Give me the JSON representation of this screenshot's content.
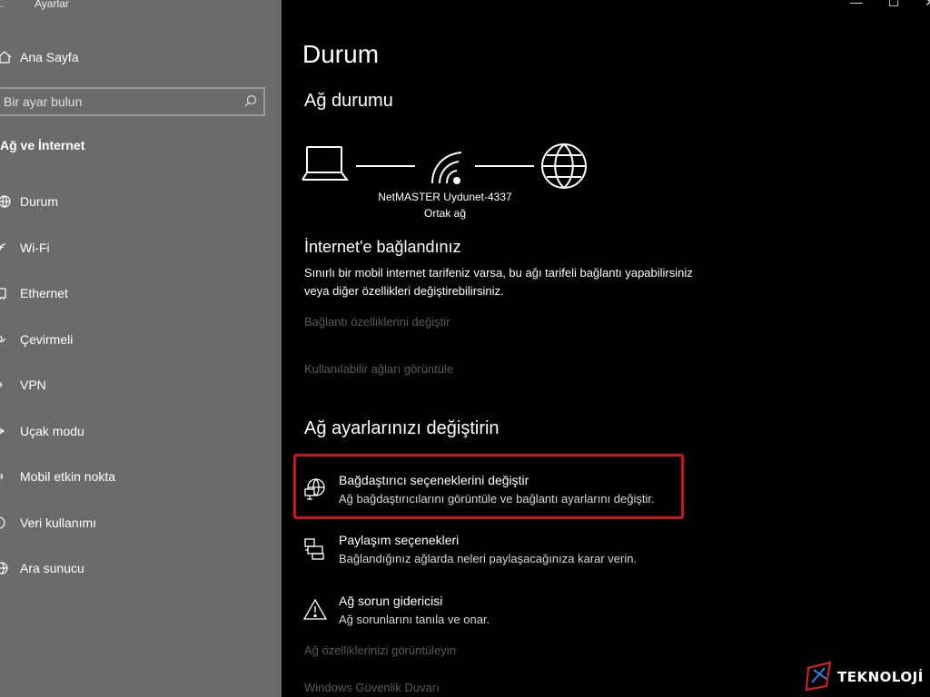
{
  "window": {
    "title": "Ayarlar",
    "back_glyph": "←",
    "controls": [
      "—",
      "☐",
      "✕"
    ]
  },
  "sidebar": {
    "home_label": "Ana Sayfa",
    "search_placeholder": "Bir ayar bulun",
    "section_title": "Ağ ve İnternet",
    "items": [
      {
        "label": "Durum",
        "icon": "globe-icon"
      },
      {
        "label": "Wi-Fi",
        "icon": "wifi-icon"
      },
      {
        "label": "Ethernet",
        "icon": "ethernet-icon"
      },
      {
        "label": "Çevirmeli",
        "icon": "dialup-icon"
      },
      {
        "label": "VPN",
        "icon": "vpn-icon"
      },
      {
        "label": "Uçak modu",
        "icon": "airplane-icon"
      },
      {
        "label": "Mobil etkin nokta",
        "icon": "hotspot-icon"
      },
      {
        "label": "Veri kullanımı",
        "icon": "data-usage-icon"
      },
      {
        "label": "Ara sunucu",
        "icon": "proxy-globe-icon"
      }
    ]
  },
  "main": {
    "title": "Durum",
    "network_status_heading": "Ağ durumu",
    "network_name": "NetMASTER Uydunet-4337",
    "network_type": "Ortak ağ",
    "connected_heading": "İnternet'e bağlandınız",
    "connected_desc": "Sınırlı bir mobil internet tarifeniz varsa, bu ağı tarifeli bağlantı yapabilirsiniz veya diğer özellikleri değiştirebilirsiniz.",
    "link_change_props": "Bağlantı özelliklerini değiştir",
    "link_view_networks": "Kullanılabilir ağları görüntüle",
    "change_heading": "Ağ ayarlarınızı değiştirin",
    "options": {
      "adapter": {
        "title": "Bağdaştırıcı seçeneklerini değiştir",
        "desc": "Ağ bağdaştırıcılarını görüntüle ve bağlantı ayarlarını değiştir.",
        "icon": "adapter-globe-icon"
      },
      "sharing": {
        "title": "Paylaşım seçenekleri",
        "desc": "Bağlandığınız ağlarda neleri paylaşacağınıza karar verin.",
        "icon": "sharing-printer-icon"
      },
      "troubleshoot": {
        "title": "Ağ sorun gidericisi",
        "desc": "Ağ sorunlarını tanıla ve onar.",
        "icon": "warning-icon"
      }
    },
    "link_view_properties": "Ağ özelliklerinizi görüntüleyin",
    "link_firewall": "Windows Güvenlik Duvarı"
  },
  "watermark": {
    "text": "TEKNOLOJİ"
  },
  "colors": {
    "sidebar_bg": "#6b6b6b",
    "main_bg": "#000000",
    "highlight": "#d0101a",
    "disabled_link": "#5a5a5a"
  }
}
